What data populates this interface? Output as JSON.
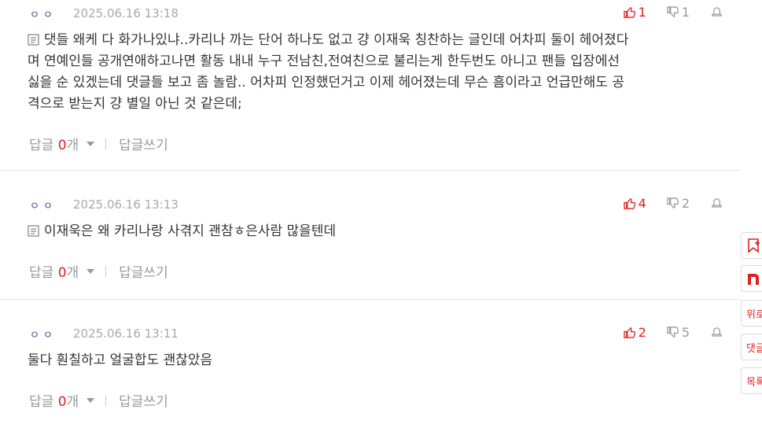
{
  "comments": [
    {
      "nick": "ㅇㅇ",
      "date": "2025.06.16 13:18",
      "likes": "1",
      "dislikes": "1",
      "has_memo_icon": true,
      "lines": [
        "댓들 왜케 다 화가나있냐..카리나 까는 단어 하나도 없고 걍 이재욱 칭찬하는 글인데 어차피 둘이 헤어졌다",
        "며 연예인들 공개연애하고나면 활동 내내 누구 전남친,전여친으로 불리는게 한두번도 아니고 팬들 입장에선",
        "싫을 순 있겠는데 댓글들 보고 좀 놀람.. 어차피 인정했던거고 이제 헤어졌는데 무슨 흠이라고 언급만해도 공",
        "격으로 받는지 걍 별일 아닌 것 같은데;"
      ],
      "reply_label": "답글",
      "reply_count": "0",
      "reply_unit": "개",
      "write_reply": "답글쓰기"
    },
    {
      "nick": "ㅇㅇ",
      "date": "2025.06.16 13:13",
      "likes": "4",
      "dislikes": "2",
      "has_memo_icon": true,
      "lines": [
        "이재욱은 왜 카리나랑 사겪지 괜참ㅎ은사람 많을텐데"
      ],
      "reply_label": "답글",
      "reply_count": "0",
      "reply_unit": "개",
      "write_reply": "답글쓰기"
    },
    {
      "nick": "ㅇㅇ",
      "date": "2025.06.16 13:11",
      "likes": "2",
      "dislikes": "5",
      "has_memo_icon": false,
      "lines": [
        "둘다 훤칠하고 얼굴합도 괜찮았음"
      ],
      "reply_label": "답글",
      "reply_count": "0",
      "reply_unit": "개",
      "write_reply": "답글쓰기"
    }
  ],
  "side_menu": {
    "top_label": "위로",
    "comments_label": "댓글",
    "list_label": "목록"
  },
  "colors": {
    "accent": "#e02020",
    "muted": "#999999",
    "nick": "#3a4a8a"
  }
}
